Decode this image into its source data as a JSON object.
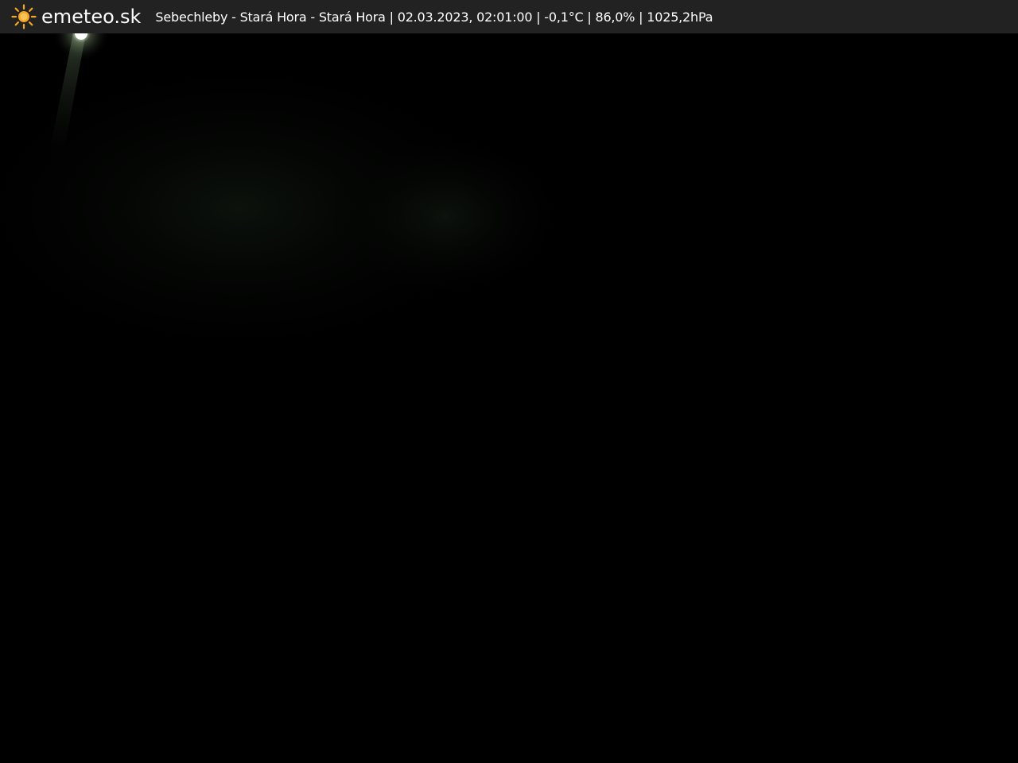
{
  "header": {
    "brand": "emeteo.sk",
    "brand_icon": "sun-icon",
    "caption": "Sebechleby - Stará Hora - Stará Hora | 02.03.2023, 02:01:00 | -0,1°C | 86,0% | 1025,2hPa"
  },
  "colors": {
    "header_background": "#222222",
    "header_text": "#ffffff",
    "sun": "#f5a623",
    "night_background": "#000000"
  }
}
